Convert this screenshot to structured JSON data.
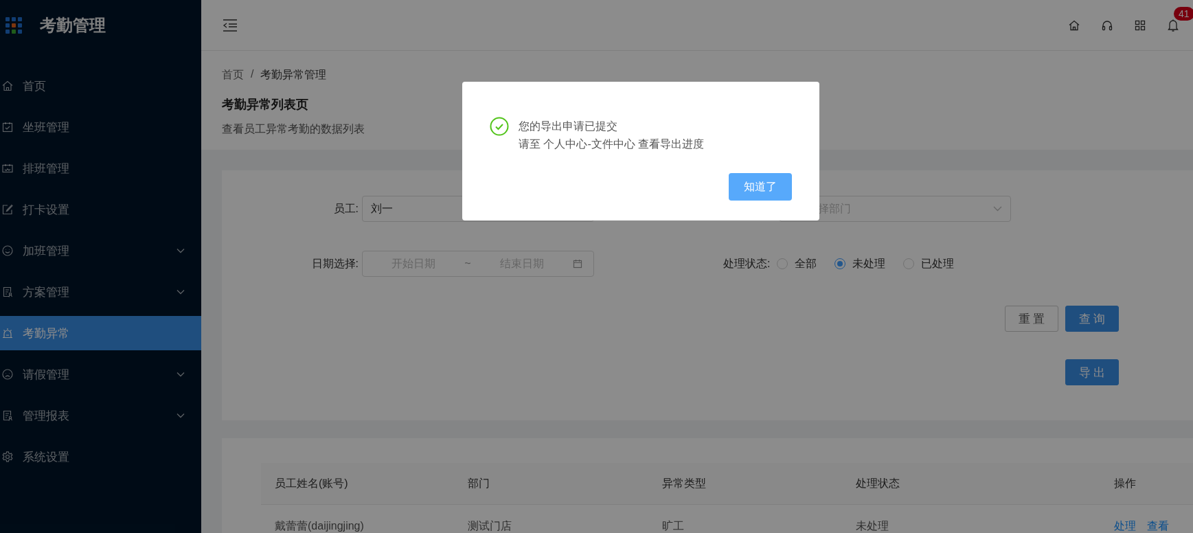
{
  "app": {
    "title": "考勤管理"
  },
  "sidebar": {
    "items": [
      {
        "label": "首页",
        "kind": "link",
        "selected": false
      },
      {
        "label": "坐班管理",
        "kind": "link",
        "selected": false
      },
      {
        "label": "排班管理",
        "kind": "link",
        "selected": false
      },
      {
        "label": "打卡设置",
        "kind": "link",
        "selected": false
      },
      {
        "label": "加班管理",
        "kind": "submenu",
        "selected": false
      },
      {
        "label": "方案管理",
        "kind": "submenu",
        "selected": false
      },
      {
        "label": "考勤异常",
        "kind": "link",
        "selected": true
      },
      {
        "label": "请假管理",
        "kind": "submenu",
        "selected": false
      },
      {
        "label": "管理报表",
        "kind": "submenu",
        "selected": false
      },
      {
        "label": "系统设置",
        "kind": "link",
        "selected": false
      }
    ]
  },
  "header": {
    "notification_count": "41"
  },
  "breadcrumb": {
    "items": [
      "首页",
      "考勤异常管理"
    ],
    "separator": "/"
  },
  "page": {
    "title": "考勤异常列表页",
    "description": "查看员工异常考勤的数据列表"
  },
  "filters": {
    "employee": {
      "label": "员工:",
      "value": "刘一"
    },
    "department": {
      "placeholder": "择部门"
    },
    "date_range": {
      "label": "日期选择:",
      "start_placeholder": "开始日期",
      "separator": "~",
      "end_placeholder": "结束日期"
    },
    "status": {
      "label": "处理状态:",
      "options": [
        {
          "label": "全部",
          "selected": false
        },
        {
          "label": "未处理",
          "selected": true
        },
        {
          "label": "已处理",
          "selected": false
        }
      ]
    },
    "buttons": [
      {
        "label": "重 置",
        "kind": "default"
      },
      {
        "label": "查 询",
        "kind": "primary"
      }
    ],
    "export_button": {
      "label": "导 出"
    }
  },
  "table": {
    "columns": [
      "员工姓名(账号)",
      "部门",
      "异常类型",
      "处理状态",
      "操作"
    ],
    "rows": [
      {
        "cells": [
          "戴蕾蕾(daijingjing)",
          "测试门店",
          "旷工",
          "未处理"
        ],
        "actions": [
          "处理",
          "查看"
        ]
      }
    ]
  },
  "dialog": {
    "title": "您的导出申请已提交",
    "message": "请至 个人中心-文件中心 查看导出进度",
    "button": "知道了"
  }
}
